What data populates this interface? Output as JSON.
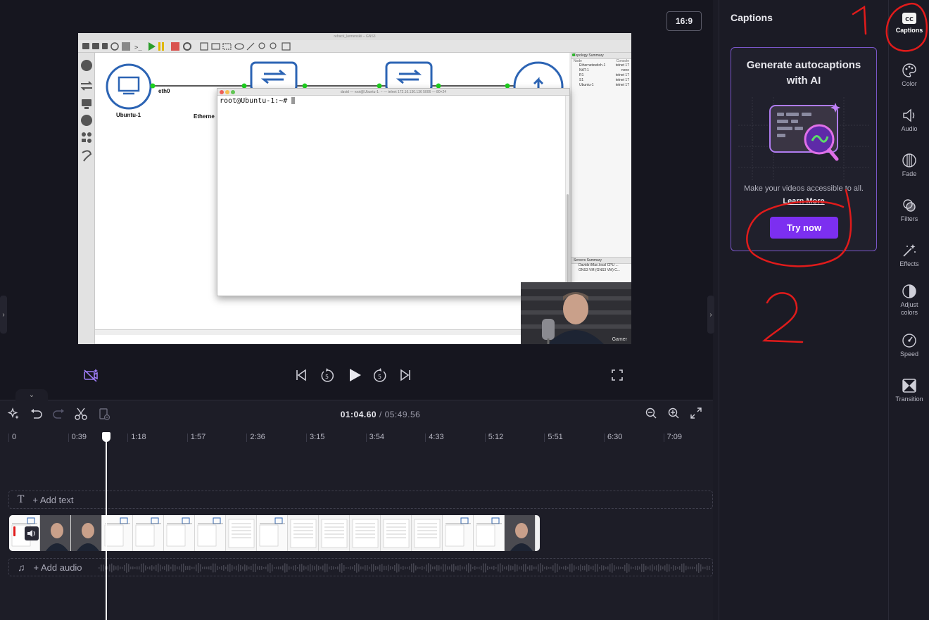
{
  "preview": {
    "aspect_ratio": "16:9",
    "video": {
      "window_title": "rehack_kemenskii – GNS3",
      "nodes": {
        "ubuntu": "Ubuntu-1",
        "eth_label": "eth0",
        "ethernet_label": "Etherne"
      },
      "terminal_title": "david — root@Ubuntu-1: ~ — telnet 172.16.130.136 5006 — 80×24",
      "terminal_prompt": "root@Ubuntu-1:~#",
      "topology_header": "Topology Summary",
      "topology_cols": [
        "Node",
        "Console"
      ],
      "topology_rows": [
        {
          "node": "Ethernetswitch-1",
          "console": "telnet 17"
        },
        {
          "node": "NAT-1",
          "console": "none"
        },
        {
          "node": "R1",
          "console": "telnet 17"
        },
        {
          "node": "S1",
          "console": "telnet 17"
        },
        {
          "node": "Ubuntu-1",
          "console": "telnet 17"
        }
      ],
      "servers_header": "Servers Summary",
      "servers_rows": [
        "Davids-iMac.local CPU ...",
        "GNS3 VM (GNS3 VM) C..."
      ],
      "webcam_caption": "Gamer"
    }
  },
  "timeline": {
    "current_time": "01:04.60",
    "total_time": "/ 05:49.56",
    "ticks": [
      "0",
      "0:39",
      "1:18",
      "1:57",
      "2:36",
      "3:15",
      "3:54",
      "4:33",
      "5:12",
      "5:51",
      "6:30",
      "7:09"
    ],
    "add_text_label": "+ Add text",
    "add_audio_label": "+ Add audio"
  },
  "panel": {
    "title": "Captions",
    "card_title": "Generate autocaptions with AI",
    "card_desc": "Make your videos accessible to all.",
    "learn_more": "Learn More",
    "try_now": "Try now"
  },
  "rail": {
    "items": [
      {
        "label": "Captions",
        "icon": "cc-icon"
      },
      {
        "label": "Color",
        "icon": "palette-icon"
      },
      {
        "label": "Audio",
        "icon": "speaker-icon"
      },
      {
        "label": "Fade",
        "icon": "fade-icon"
      },
      {
        "label": "Filters",
        "icon": "filters-icon"
      },
      {
        "label": "Effects",
        "icon": "magic-wand-icon"
      },
      {
        "label": "Adjust colors",
        "icon": "contrast-icon"
      },
      {
        "label": "Speed",
        "icon": "speedometer-icon"
      },
      {
        "label": "Transition",
        "icon": "transition-icon"
      }
    ]
  },
  "annotations": {
    "marker_1": "1",
    "marker_2": "2",
    "color": "#e01b1b"
  },
  "colors": {
    "accent": "#7c2ff0",
    "card_border": "#7a56c8",
    "background": "#1b1b25"
  }
}
